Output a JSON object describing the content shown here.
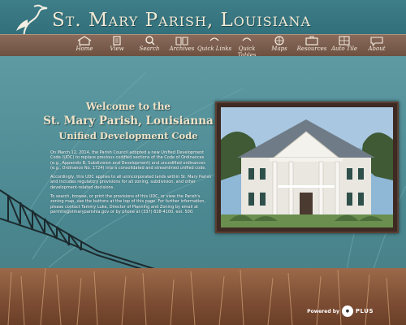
{
  "header": {
    "site_title": "St. Mary Parish, Louisiana"
  },
  "nav": {
    "items": [
      {
        "label": "Home",
        "icon": "house-icon"
      },
      {
        "label": "View",
        "icon": "document-icon"
      },
      {
        "label": "Search",
        "icon": "magnifier-icon"
      },
      {
        "label": "Archives",
        "icon": "books-icon"
      },
      {
        "label": "Quick Links",
        "icon": "links-icon"
      },
      {
        "label": "Quick Tables",
        "icon": "tables-icon"
      },
      {
        "label": "Maps",
        "icon": "globe-icon"
      },
      {
        "label": "Resources",
        "icon": "briefcase-icon"
      },
      {
        "label": "Auto Tile",
        "icon": "tile-icon"
      },
      {
        "label": "About",
        "icon": "speech-bubble-icon"
      }
    ]
  },
  "welcome": {
    "line1": "Welcome to the",
    "line2": "St. Mary Parish, Louisianna",
    "line3": "Unified Development Code"
  },
  "intro": {
    "p1": "On March 12, 2014, the Parish Council adopted a new Unified Development Code (UDC) to replace previous codified sections of the Code of Ordinances (e.g., Appendix B, Subdivision and Development) and uncodified ordinances (e.g., Ordinance No. 1724) into a consolidated and streamlined unified code.",
    "p2": "Accordingly, this UDC applies to all unincorporated lands within St. Mary Parish and includes regulatory provisions for all zoning, subdivision, and other development-related decisions.",
    "p3": "To search, browse, or print the provisions of this UDC, or view the Parish's zoning map, use the buttons at the top of this page. For further information, please contact Tammy Luke, Director of Planning and Zoning by email at permits@stmaryparishla.gov or by phone at (337) 828-4100, ext. 500."
  },
  "footer": {
    "powered_by": "Powered by",
    "brand": "PLUS"
  },
  "colors": {
    "header_bg": "#3e7e89",
    "nav_bg": "#7a5c4b",
    "title_text": "#f2ead6",
    "welcome_text": "#efe3c7"
  }
}
